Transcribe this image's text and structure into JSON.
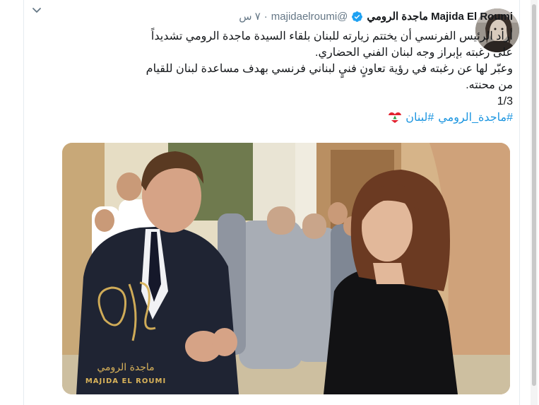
{
  "tweet": {
    "author_name": "Majida El Roumi ماجدة الرومي",
    "handle": "@majidaelroumi",
    "separator": "·",
    "time": "٧ س",
    "lines": [
      "أراد الرئيس الفرنسي أن يختتم زيارته للبنان بلقاء السيدة ماجدة الرومي تشديداً",
      "على رغبته بإبراز وجه لبنان الفني الحضاري.",
      "وعبّر لها عن رغبته في رؤية تعاونٍ فنيٍ لبناني فرنسي بهدف مساعدة لبنان للقيام",
      "من محنته.",
      "1/3"
    ],
    "hashtags": [
      "#ماجدة_الرومي",
      "#لبنان"
    ]
  },
  "photo": {
    "watermark_name_ar": "ماجدة الرومي",
    "watermark_name_en": "MAJIDA EL ROUMI"
  },
  "icons": {
    "verified": "verified-badge-icon",
    "chevron": "chevron-down-icon",
    "flag_heart": "lebanon-heart-icon"
  },
  "colors": {
    "link": "#1b95e0",
    "verified": "#1da1f2",
    "muted": "#657786"
  }
}
